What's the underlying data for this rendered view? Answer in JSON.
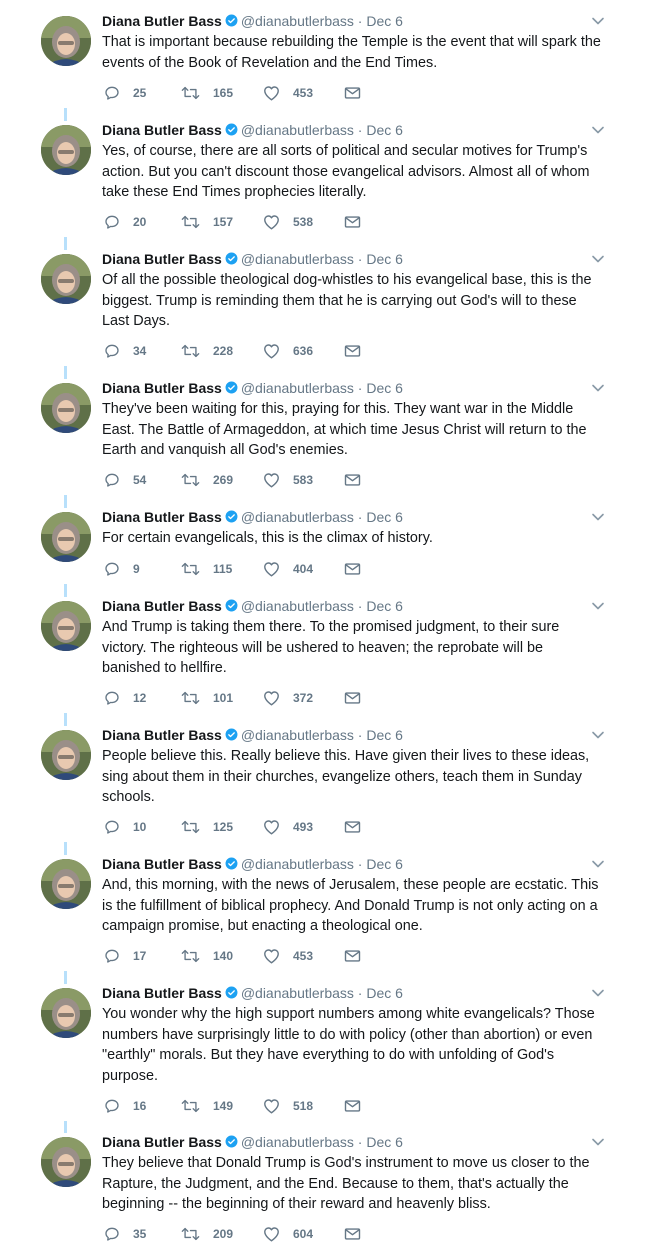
{
  "author": {
    "name": "Diana Butler Bass",
    "handle": "@dianabutlerbass",
    "date": "Dec 6"
  },
  "colors": {
    "accent": "#1da1f2",
    "thread_line": "#b8e0fb",
    "secondary_text": "#657786"
  },
  "icons": {
    "reply": "speech-bubble",
    "retweet": "retweet-arrows",
    "like": "heart-outline",
    "dm": "envelope",
    "menu": "chevron-down",
    "verified": "verified-badge"
  },
  "tweets": [
    {
      "text": "That is important because rebuilding the Temple is the event that will spark the events of the Book of Revelation and the End Times.",
      "replies": "25",
      "retweets": "165",
      "likes": "453"
    },
    {
      "text": "Yes, of course, there are all sorts of political and secular motives for Trump's action.  But you can't discount those evangelical advisors.  Almost all of whom take these End Times prophecies literally.",
      "replies": "20",
      "retweets": "157",
      "likes": "538"
    },
    {
      "text": "Of all the possible theological dog-whistles to his evangelical base, this is the biggest.  Trump is reminding them that he is carrying out God's will to these Last Days.",
      "replies": "34",
      "retweets": "228",
      "likes": "636"
    },
    {
      "text": "They've been waiting for this, praying for this.  They want war in the Middle East.  The Battle of Armageddon, at which time Jesus Christ will return to the Earth and vanquish all God's enemies.",
      "replies": "54",
      "retweets": "269",
      "likes": "583"
    },
    {
      "text": "For certain evangelicals, this is the climax of history.",
      "replies": "9",
      "retweets": "115",
      "likes": "404"
    },
    {
      "text": "And Trump is taking them there.  To the promised judgment, to their sure victory. The righteous will be ushered to heaven; the reprobate will be banished to hellfire.",
      "replies": "12",
      "retweets": "101",
      "likes": "372"
    },
    {
      "text": "People believe this.  Really believe this.  Have given their lives to these ideas, sing about them in their churches, evangelize others, teach them in Sunday schools.",
      "replies": "10",
      "retweets": "125",
      "likes": "493"
    },
    {
      "text": "And, this morning, with the news of Jerusalem, these people are ecstatic.  This is the fulfillment of biblical prophecy.  And Donald Trump is not only acting on a campaign promise, but enacting a theological one.",
      "replies": "17",
      "retweets": "140",
      "likes": "453"
    },
    {
      "text": "You wonder why the high support numbers among white evangelicals?  Those numbers have surprisingly little to do with policy (other than abortion) or even \"earthly\" morals.  But they have everything to do with unfolding of God's purpose.",
      "replies": "16",
      "retweets": "149",
      "likes": "518"
    },
    {
      "text": "They believe that Donald Trump is God's instrument to move us closer to the Rapture, the Judgment, and the End.  Because to them, that's actually the beginning -- the beginning of their reward and heavenly bliss.",
      "replies": "35",
      "retweets": "209",
      "likes": "604"
    }
  ]
}
